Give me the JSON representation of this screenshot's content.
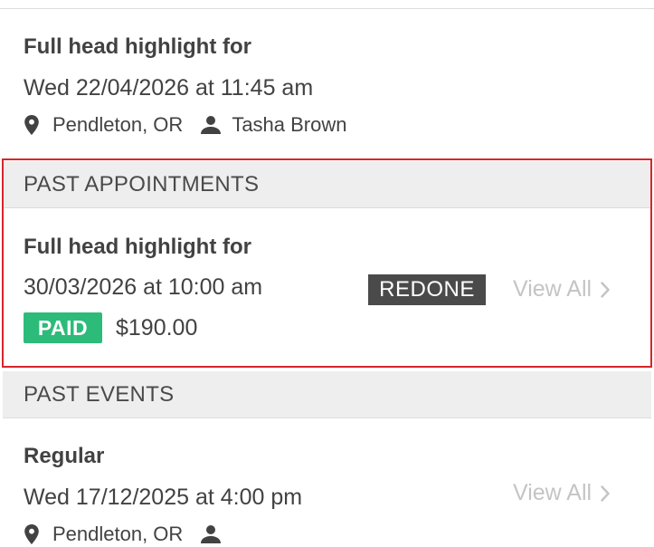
{
  "upcoming_appointment": {
    "title": "Full head highlight for",
    "datetime": "Wed 22/04/2026 at 11:45 am",
    "location": "Pendleton, OR",
    "staff": "Tasha Brown"
  },
  "past_appointments": {
    "header": "PAST APPOINTMENTS",
    "item": {
      "title": "Full head highlight for",
      "datetime": "30/03/2026 at 10:00 am",
      "status_badge": "REDONE",
      "payment_badge": "PAID",
      "amount": "$190.00"
    },
    "view_all_label": "View All"
  },
  "past_events": {
    "header": "PAST EVENTS",
    "item": {
      "title": "Regular",
      "datetime": "Wed 17/12/2025 at 4:00 pm",
      "location": "Pendleton, OR"
    },
    "view_all_label": "View All"
  },
  "colors": {
    "highlight_border": "#d8262b",
    "paid_badge": "#2dbb7a",
    "redone_badge": "#4a4a4a",
    "view_all": "#c4c4c4"
  },
  "icons": [
    "location-pin-icon",
    "person-icon",
    "chevron-right-icon"
  ]
}
